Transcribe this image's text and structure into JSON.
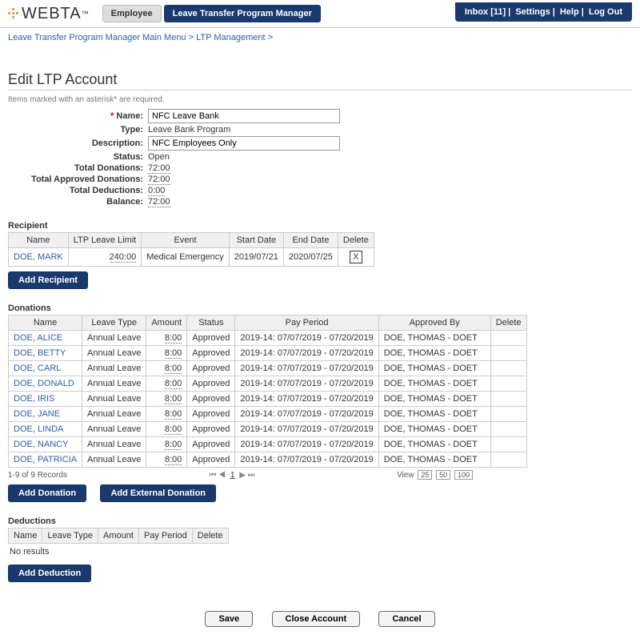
{
  "header": {
    "logo": "WEBTA",
    "tm": "™",
    "tabs": [
      {
        "label": "Employee",
        "active": false
      },
      {
        "label": "Leave Transfer Program Manager",
        "active": true
      }
    ],
    "inbox_label": "Inbox [11]",
    "settings": "Settings",
    "help": "Help",
    "logout": "Log Out"
  },
  "breadcrumb": {
    "a": "Leave Transfer Program Manager Main Menu",
    "b": "LTP Management",
    "sep": ">"
  },
  "page_title": "Edit LTP Account",
  "hint": "Items marked with an asterisk* are required.",
  "form": {
    "name_label": "Name:",
    "name_value": "NFC Leave Bank",
    "type_label": "Type:",
    "type_value": "Leave Bank Program",
    "desc_label": "Description:",
    "desc_value": "NFC Employees Only",
    "status_label": "Status:",
    "status_value": "Open",
    "td_label": "Total Donations:",
    "td_value": "72:00",
    "tad_label": "Total Approved Donations:",
    "tad_value": "72:00",
    "tded_label": "Total Deductions:",
    "tded_value": "0:00",
    "bal_label": "Balance:",
    "bal_value": "72:00"
  },
  "recipient": {
    "title": "Recipient",
    "cols": {
      "c1": "Name",
      "c2": "LTP Leave Limit",
      "c3": "Event",
      "c4": "Start Date",
      "c5": "End Date",
      "c6": "Delete"
    },
    "rows": [
      {
        "name": "DOE, MARK",
        "limit": "240:00",
        "event": "Medical Emergency",
        "start": "2019/07/21",
        "end": "2020/07/25"
      }
    ],
    "add_btn": "Add Recipient"
  },
  "donations": {
    "title": "Donations",
    "cols": {
      "c1": "Name",
      "c2": "Leave Type",
      "c3": "Amount",
      "c4": "Status",
      "c5": "Pay Period",
      "c6": "Approved By",
      "c7": "Delete"
    },
    "rows": [
      {
        "name": "DOE, ALICE",
        "lt": "Annual Leave",
        "amt": "8:00",
        "st": "Approved",
        "pp": "2019-14: 07/07/2019 - 07/20/2019",
        "ap": "DOE, THOMAS - DOET"
      },
      {
        "name": "DOE, BETTY",
        "lt": "Annual Leave",
        "amt": "8:00",
        "st": "Approved",
        "pp": "2019-14: 07/07/2019 - 07/20/2019",
        "ap": "DOE, THOMAS - DOET"
      },
      {
        "name": "DOE, CARL",
        "lt": "Annual Leave",
        "amt": "8:00",
        "st": "Approved",
        "pp": "2019-14: 07/07/2019 - 07/20/2019",
        "ap": "DOE, THOMAS - DOET"
      },
      {
        "name": "DOE, DONALD",
        "lt": "Annual Leave",
        "amt": "8:00",
        "st": "Approved",
        "pp": "2019-14: 07/07/2019 - 07/20/2019",
        "ap": "DOE, THOMAS - DOET"
      },
      {
        "name": "DOE, IRIS",
        "lt": "Annual Leave",
        "amt": "8:00",
        "st": "Approved",
        "pp": "2019-14: 07/07/2019 - 07/20/2019",
        "ap": "DOE, THOMAS - DOET"
      },
      {
        "name": "DOE, JANE",
        "lt": "Annual Leave",
        "amt": "8:00",
        "st": "Approved",
        "pp": "2019-14: 07/07/2019 - 07/20/2019",
        "ap": "DOE, THOMAS - DOET"
      },
      {
        "name": "DOE, LINDA",
        "lt": "Annual Leave",
        "amt": "8:00",
        "st": "Approved",
        "pp": "2019-14: 07/07/2019 - 07/20/2019",
        "ap": "DOE, THOMAS - DOET"
      },
      {
        "name": "DOE, NANCY",
        "lt": "Annual Leave",
        "amt": "8:00",
        "st": "Approved",
        "pp": "2019-14: 07/07/2019 - 07/20/2019",
        "ap": "DOE, THOMAS - DOET"
      },
      {
        "name": "DOE, PATRICIA",
        "lt": "Annual Leave",
        "amt": "8:00",
        "st": "Approved",
        "pp": "2019-14: 07/07/2019 - 07/20/2019",
        "ap": "DOE, THOMAS - DOET"
      }
    ],
    "pager_left": "1-9 of 9 Records",
    "pager_view": "View",
    "pager_25": "25",
    "pager_50": "50",
    "pager_100": "100",
    "pager_page": "1",
    "add_btn": "Add Donation",
    "add_ext_btn": "Add External Donation"
  },
  "deductions": {
    "title": "Deductions",
    "cols": {
      "c1": "Name",
      "c2": "Leave Type",
      "c3": "Amount",
      "c4": "Pay Period",
      "c5": "Delete"
    },
    "noresults": "No results",
    "add_btn": "Add Deduction"
  },
  "footer": {
    "save": "Save",
    "close": "Close Account",
    "cancel": "Cancel"
  }
}
